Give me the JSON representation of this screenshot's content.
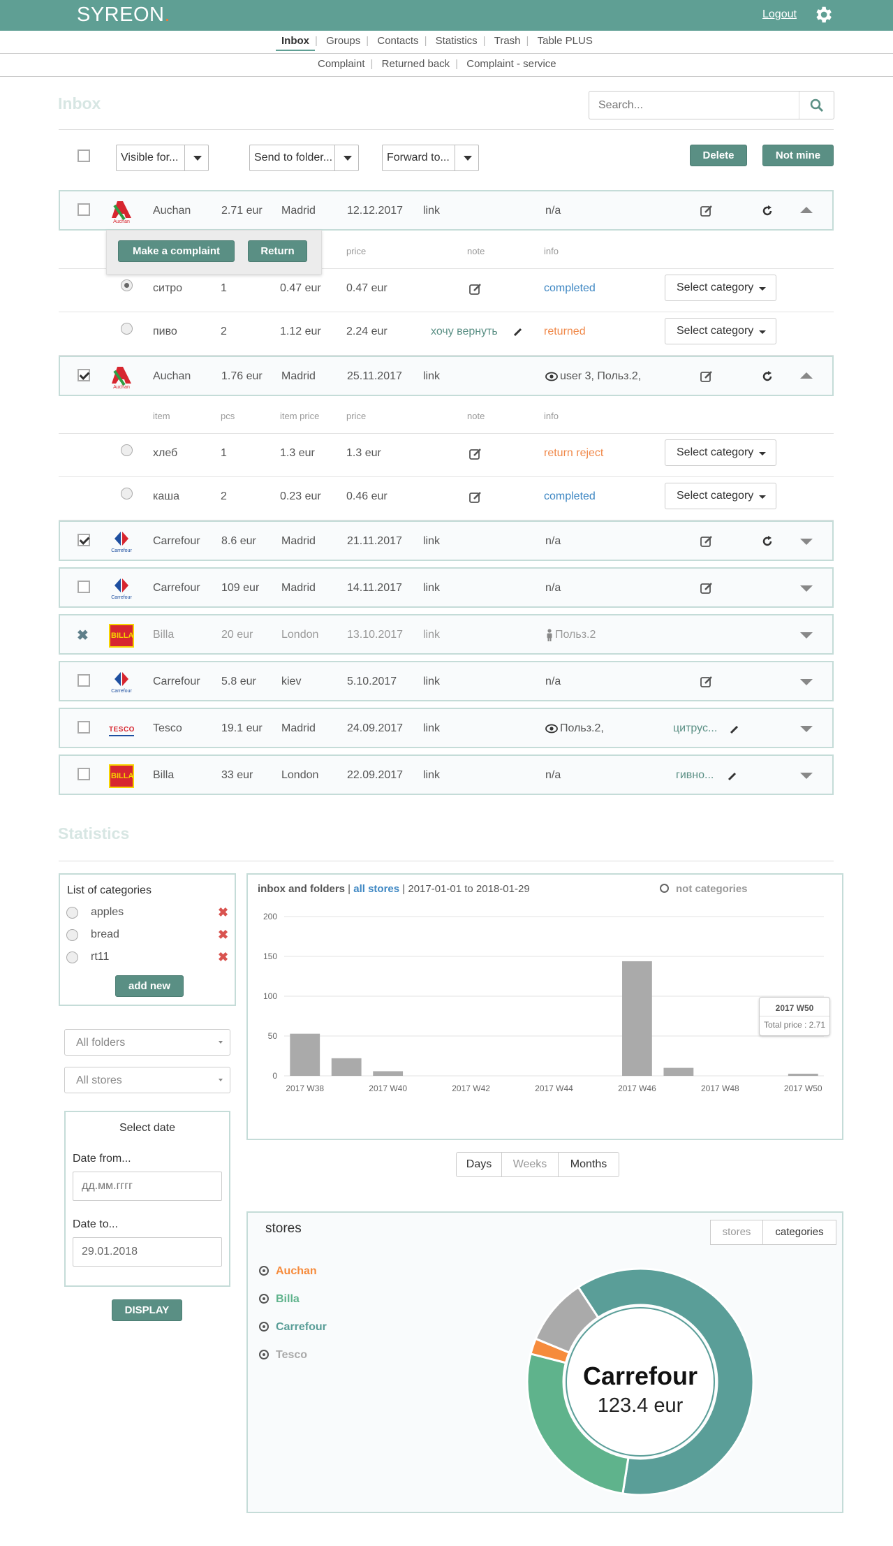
{
  "header": {
    "logo_text": "SYREON",
    "logo_dot": ".",
    "logout": "Logout",
    "settings_icon": "gear-icon"
  },
  "nav": {
    "main": [
      "Inbox",
      "Groups",
      "Contacts",
      "Statistics",
      "Trash",
      "Table PLUS"
    ],
    "active": "Inbox",
    "sub": [
      "Complaint",
      "Returned back",
      "Complaint - service"
    ]
  },
  "inbox": {
    "title": "Inbox",
    "search_placeholder": "Search...",
    "toolbar": {
      "visible_for": "Visible for...",
      "send_to_folder": "Send to folder...",
      "forward_to": "Forward to...",
      "delete": "Delete",
      "not_mine": "Not mine"
    },
    "popup": {
      "complaint": "Make a complaint",
      "return": "Return"
    },
    "rows": [
      {
        "store": "Auchan",
        "amount": "2.71 eur",
        "city": "Madrid",
        "date": "12.12.2017",
        "link": "link",
        "info": "n/a",
        "checked": false,
        "expanded": true
      },
      {
        "store": "Auchan",
        "amount": "1.76 eur",
        "city": "Madrid",
        "date": "25.11.2017",
        "link": "link",
        "info": "user 3, Польз.2,",
        "checked": true,
        "expanded": true
      },
      {
        "store": "Carrefour",
        "amount": "8.6 eur",
        "city": "Madrid",
        "date": "21.11.2017",
        "link": "link",
        "info": "n/a",
        "checked": true
      },
      {
        "store": "Carrefour",
        "amount": "109 eur",
        "city": "Madrid",
        "date": "14.11.2017",
        "link": "link",
        "info": "n/a",
        "checked": false
      },
      {
        "store": "Billa",
        "amount": "20 eur",
        "city": "London",
        "date": "13.10.2017",
        "link": "link",
        "info": "Польз.2",
        "rejected": true
      },
      {
        "store": "Carrefour",
        "amount": "5.8 eur",
        "city": "kiev",
        "date": "5.10.2017",
        "link": "link",
        "info": "n/a",
        "checked": false
      },
      {
        "store": "Tesco",
        "amount": "19.1 eur",
        "city": "Madrid",
        "date": "24.09.2017",
        "link": "link",
        "info": "Польз.2,",
        "note": "цитрус...",
        "checked": false
      },
      {
        "store": "Billa",
        "amount": "33 eur",
        "city": "London",
        "date": "22.09.2017",
        "link": "link",
        "info": "n/a",
        "note": "гивно...",
        "checked": false
      }
    ],
    "headers_partial": {
      "price": "price",
      "note": "note",
      "info": "info"
    },
    "headers": {
      "item": "item",
      "pcs": "pcs",
      "item_price": "item price",
      "price": "price",
      "note": "note",
      "info": "info"
    },
    "items_1": [
      {
        "item": "ситро",
        "pcs": "1",
        "item_price": "0.47 eur",
        "price": "0.47 eur",
        "status": "completed",
        "selected": true
      },
      {
        "item": "пиво",
        "pcs": "2",
        "item_price": "1.12 eur",
        "price": "2.24 eur",
        "note": "хочу вернуть",
        "status": "returned"
      }
    ],
    "items_2": [
      {
        "item": "хлеб",
        "pcs": "1",
        "item_price": "1.3 eur",
        "price": "1.3 eur",
        "status": "return reject"
      },
      {
        "item": "каша",
        "pcs": "2",
        "item_price": "0.23 eur",
        "price": "0.46 eur",
        "status": "completed"
      }
    ],
    "select_category": "Select category"
  },
  "statistics": {
    "title": "Statistics",
    "categories_title": "List of categories",
    "categories": [
      "apples",
      "bread",
      "rt11"
    ],
    "add_new": "add new",
    "all_folders": "All folders",
    "all_stores": "All stores",
    "select_date": "Select date",
    "date_from_label": "Date from...",
    "date_from_placeholder": "дд.мм.гггг",
    "date_to_label": "Date to...",
    "date_to_value": "29.01.2018",
    "display": "DISPLAY",
    "chart_header": {
      "part1": "inbox and folders",
      "sep1": " | ",
      "part2": "all stores",
      "sep2": " | ",
      "part3": "2017-01-01 to 2018-01-29",
      "not_categories": "not categories"
    },
    "tooltip": {
      "title": "2017 W50",
      "label": "Total price : 2.71"
    },
    "toggle": [
      "Days",
      "Weeks",
      "Months"
    ],
    "stores_panel": {
      "title": "stores",
      "tabs": [
        "stores",
        "categories"
      ],
      "center_name": "Carrefour",
      "center_value": "123.4 eur"
    }
  },
  "chart_data": [
    {
      "type": "bar",
      "title": "",
      "categories": [
        "2017 W38",
        "2017 W39",
        "2017 W40",
        "2017 W41",
        "2017 W42",
        "2017 W43",
        "2017 W44",
        "2017 W45",
        "2017 W46",
        "2017 W47",
        "2017 W48",
        "2017 W49",
        "2017 W50"
      ],
      "tick_labels": [
        "2017 W38",
        "2017 W40",
        "2017 W42",
        "2017 W44",
        "2017 W46",
        "2017 W48",
        "2017 W50"
      ],
      "values": [
        52.9,
        22.1,
        5.8,
        0,
        0,
        0,
        0,
        0,
        143.9,
        10,
        0,
        0,
        2.71
      ],
      "ylim": [
        0,
        200
      ],
      "yticks": [
        0,
        50,
        100,
        150,
        200
      ],
      "grid": true,
      "color": "#aaaaaa"
    },
    {
      "type": "pie",
      "donut": true,
      "labels": [
        "Auchan",
        "Billa",
        "Carrefour",
        "Tesco"
      ],
      "values": [
        4.47,
        53,
        123.4,
        19.1
      ],
      "colors": [
        "#f68b3c",
        "#5fb38c",
        "#5a9e98",
        "#aaaaaa"
      ]
    }
  ]
}
